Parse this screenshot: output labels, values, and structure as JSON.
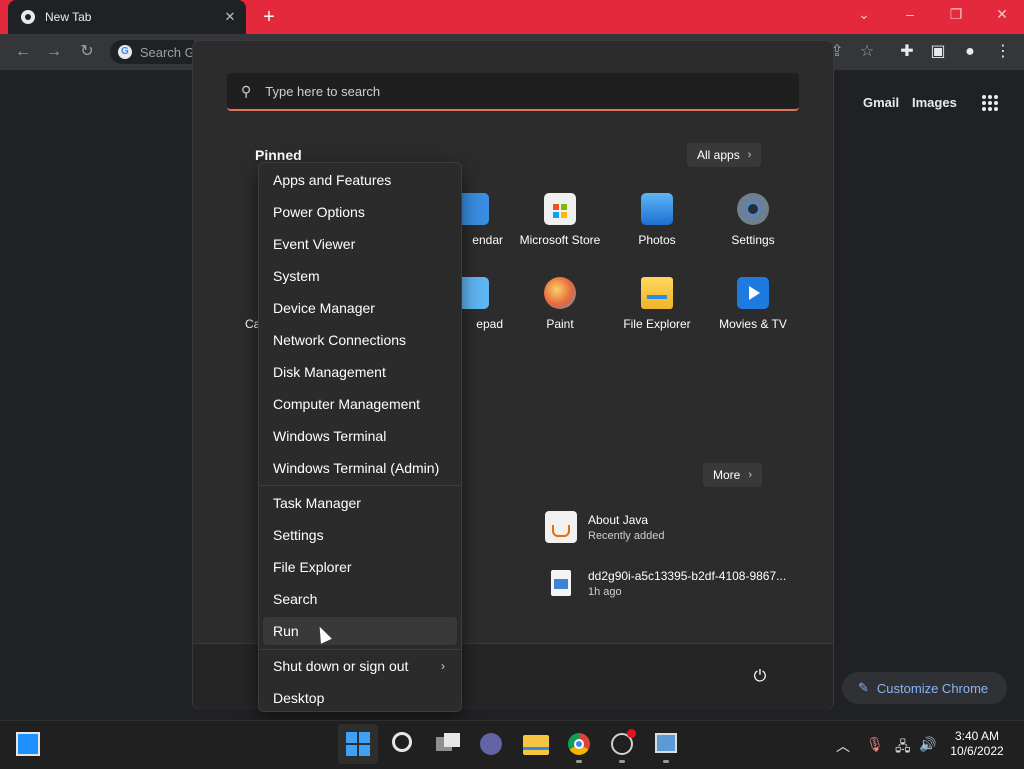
{
  "browser": {
    "tab_title": "New Tab",
    "tab_close": "✕",
    "new_tab": "+",
    "omnibox_placeholder": "Search G",
    "links": [
      "Gmail",
      "Images"
    ],
    "customize_label": "Customize Chrome"
  },
  "start": {
    "search_placeholder": "Type here to search",
    "pinned_heading": "Pinned",
    "all_apps_label": "All apps",
    "more_label": "More",
    "pinned_apps": [
      {
        "label": "endar",
        "icon": "calendar-icon",
        "color": "#3a8de0"
      },
      {
        "label": "Microsoft Store",
        "icon": "microsoft-store-icon",
        "color": "#f0f0f0"
      },
      {
        "label": "Photos",
        "icon": "photos-icon",
        "color": "#3b9ae6"
      },
      {
        "label": "Settings",
        "icon": "settings-gear-icon",
        "color": "#7a8a99"
      },
      {
        "label": "Ca",
        "icon": "calculator-icon",
        "color": "#3a8de0"
      },
      {
        "label": "epad",
        "icon": "notepad-icon",
        "color": "#60b4f2"
      },
      {
        "label": "Paint",
        "icon": "paint-icon",
        "color": "#f2a73a"
      },
      {
        "label": "File Explorer",
        "icon": "file-explorer-icon",
        "color": "#f5c542"
      },
      {
        "label": "Movies & TV",
        "icon": "movies-tv-icon",
        "color": "#1f7adf"
      }
    ],
    "recommended": [
      {
        "title": "About Java",
        "sub": "Recently added",
        "icon": "java-icon"
      },
      {
        "title": "dd2g90i-a5c13395-b2df-4108-9867...",
        "sub": "1h ago",
        "icon": "image-file-icon"
      }
    ]
  },
  "context_menu": {
    "group1": [
      "Apps and Features",
      "Power Options",
      "Event Viewer",
      "System",
      "Device Manager",
      "Network Connections",
      "Disk Management",
      "Computer Management",
      "Windows Terminal",
      "Windows Terminal (Admin)"
    ],
    "group2": [
      "Task Manager",
      "Settings",
      "File Explorer",
      "Search",
      "Run"
    ],
    "shutdown_label": "Shut down or sign out",
    "desktop_label": "Desktop",
    "hovered": "Run"
  },
  "taskbar": {
    "time": "3:40 AM",
    "date": "10/6/2022",
    "apps": [
      "start-button-icon",
      "search-icon",
      "task-view-icon",
      "teams-chat-icon",
      "file-explorer-icon",
      "chrome-icon",
      "obs-icon",
      "remote-desktop-icon"
    ],
    "tray": [
      "chevron-up-icon",
      "microphone-icon",
      "network-icon",
      "volume-icon"
    ]
  },
  "colors": {
    "accent_tabstrip": "#e3293b",
    "search_underline": "#e0735d",
    "link_blue": "#8ab4f8"
  }
}
